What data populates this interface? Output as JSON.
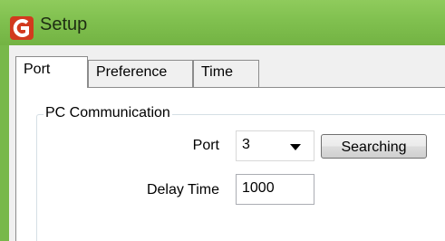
{
  "window": {
    "title": "Setup",
    "icon": "app-logo-icon",
    "accent_color": "#7fbf4e"
  },
  "tabs": [
    {
      "label": "Port",
      "active": true
    },
    {
      "label": "Preference",
      "active": false
    },
    {
      "label": "Time",
      "active": false
    }
  ],
  "pc_communication": {
    "group_label": "PC Communication",
    "port": {
      "label": "Port",
      "value": "3"
    },
    "searching_button": "Searching",
    "delay_time": {
      "label": "Delay Time",
      "value": "1000"
    }
  }
}
